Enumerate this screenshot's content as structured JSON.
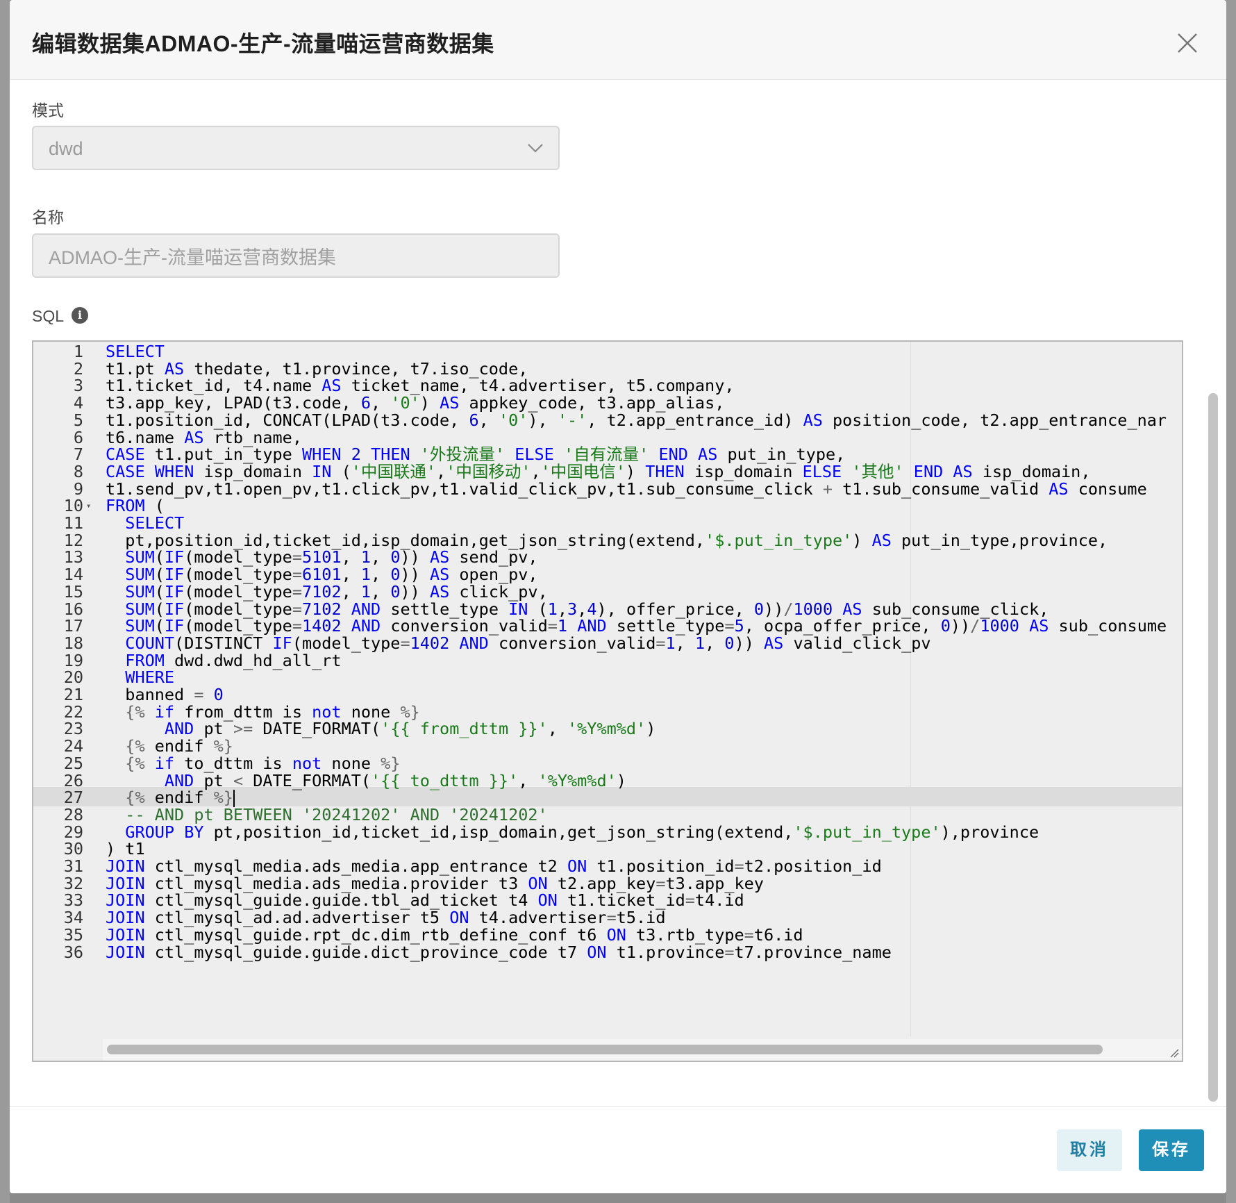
{
  "dialog": {
    "title": "编辑数据集ADMAO-生产-流量喵运营商数据集",
    "close_icon": "close-icon"
  },
  "form": {
    "mode_label": "模式",
    "mode_value": "dwd",
    "name_label": "名称",
    "name_value": "ADMAO-生产-流量喵运营商数据集",
    "sql_label": "SQL",
    "sql_info_icon": "info-icon"
  },
  "editor": {
    "active_line": 27,
    "fold_line": 10,
    "lines": [
      "SELECT",
      "t1.pt AS thedate, t1.province, t7.iso_code,",
      "t1.ticket_id, t4.name AS ticket_name, t4.advertiser, t5.company,",
      "t3.app_key, LPAD(t3.code, 6, '0') AS appkey_code, t3.app_alias,",
      "t1.position_id, CONCAT(LPAD(t3.code, 6, '0'), '-', t2.app_entrance_id) AS position_code, t2.app_entrance_nar",
      "t6.name AS rtb_name,",
      "CASE t1.put_in_type WHEN 2 THEN '外投流量' ELSE '自有流量' END AS put_in_type,",
      "CASE WHEN isp_domain IN ('中国联通','中国移动','中国电信') THEN isp_domain ELSE '其他' END AS isp_domain,",
      "t1.send_pv,t1.open_pv,t1.click_pv,t1.valid_click_pv,t1.sub_consume_click + t1.sub_consume_valid AS consume",
      "FROM (",
      "  SELECT",
      "  pt,position_id,ticket_id,isp_domain,get_json_string(extend,'$.put_in_type') AS put_in_type,province,",
      "  SUM(IF(model_type=5101, 1, 0)) AS send_pv,",
      "  SUM(IF(model_type=6101, 1, 0)) AS open_pv,",
      "  SUM(IF(model_type=7102, 1, 0)) AS click_pv,",
      "  SUM(IF(model_type=7102 AND settle_type IN (1,3,4), offer_price, 0))/1000 AS sub_consume_click,",
      "  SUM(IF(model_type=1402 AND conversion_valid=1 AND settle_type=5, ocpa_offer_price, 0))/1000 AS sub_consume",
      "  COUNT(DISTINCT IF(model_type=1402 AND conversion_valid=1, 1, 0)) AS valid_click_pv",
      "  FROM dwd.dwd_hd_all_rt",
      "  WHERE",
      "  banned = 0",
      "  {% if from_dttm is not none %}",
      "      AND pt >= DATE_FORMAT('{{ from_dttm }}', '%Y%m%d')",
      "  {% endif %}",
      "  {% if to_dttm is not none %}",
      "      AND pt < DATE_FORMAT('{{ to_dttm }}', '%Y%m%d')",
      "  {% endif %}",
      "  -- AND pt BETWEEN '20241202' AND '20241202'",
      "  GROUP BY pt,position_id,ticket_id,isp_domain,get_json_string(extend,'$.put_in_type'),province",
      ") t1",
      "JOIN ctl_mysql_media.ads_media.app_entrance t2 ON t1.position_id=t2.position_id",
      "JOIN ctl_mysql_media.ads_media.provider t3 ON t2.app_key=t3.app_key",
      "JOIN ctl_mysql_guide.guide.tbl_ad_ticket t4 ON t1.ticket_id=t4.id",
      "JOIN ctl_mysql_ad.ad.advertiser t5 ON t4.advertiser=t5.id",
      "JOIN ctl_mysql_guide.rpt_dc.dim_rtb_define_conf t6 ON t3.rtb_type=t6.id",
      "JOIN ctl_mysql_guide.guide.dict_province_code t7 ON t1.province=t7.province_name"
    ]
  },
  "footer": {
    "cancel_label": "取消",
    "save_label": "保存"
  },
  "colors": {
    "keyword": "#0000ff",
    "string": "#1a7a1a",
    "number": "#0000cd",
    "primary_button": "#1f8fb8",
    "secondary_button_bg": "#e4f2f6"
  }
}
